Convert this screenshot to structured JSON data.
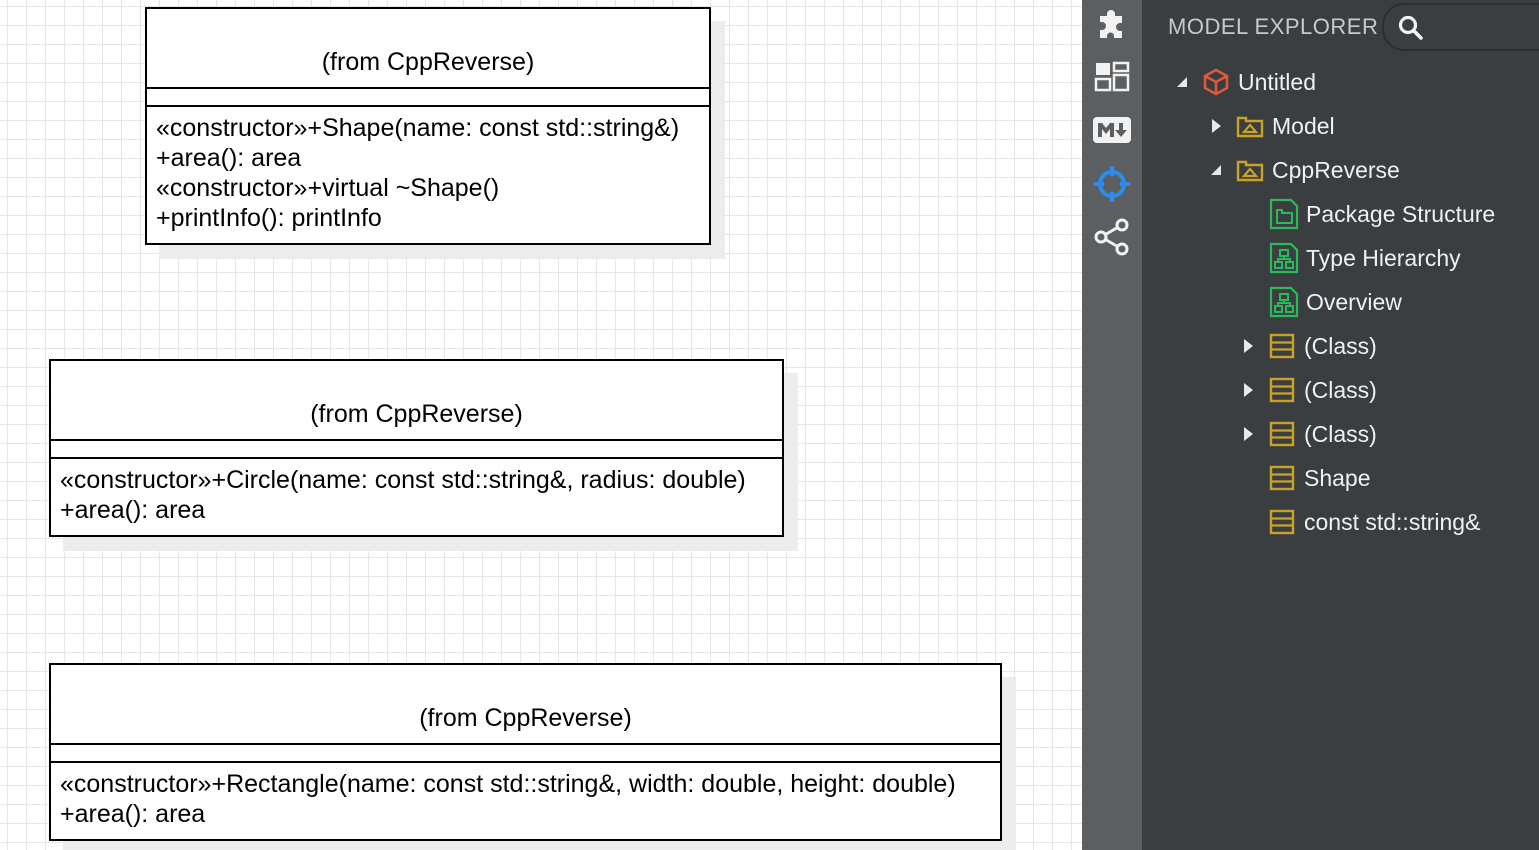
{
  "diagram": {
    "classes": [
      {
        "from": "(from CppReverse)",
        "operations": [
          "«constructor»+Shape(name: const std::string&)",
          "+area(): area",
          "«constructor»+virtual ~Shape()",
          "+printInfo(): printInfo"
        ]
      },
      {
        "from": "(from CppReverse)",
        "operations": [
          "«constructor»+Circle(name: const std::string&, radius: double)",
          "+area(): area"
        ]
      },
      {
        "from": "(from CppReverse)",
        "operations": [
          "«constructor»+Rectangle(name: const std::string&, width: double, height: double)",
          "+area(): area"
        ]
      }
    ]
  },
  "activity_bar": {
    "items": [
      "puzzle-icon",
      "dashboard-icon",
      "markdown-icon",
      "crosshair-icon",
      "share-icon"
    ],
    "active": "crosshair-icon",
    "active_color": "#2d8cf0"
  },
  "explorer": {
    "title": "MODEL EXPLORER",
    "search_icon": "search-icon",
    "tree": [
      {
        "label": "Untitled",
        "icon": "project-cube-icon",
        "state": "expanded"
      },
      {
        "label": "Model",
        "icon": "package-icon",
        "state": "collapsed"
      },
      {
        "label": "CppReverse",
        "icon": "package-icon",
        "state": "expanded"
      },
      {
        "label": "Package Structure",
        "icon": "package-diagram-icon",
        "state": "leaf"
      },
      {
        "label": "Type Hierarchy",
        "icon": "class-diagram-icon",
        "state": "leaf"
      },
      {
        "label": "Overview",
        "icon": "class-diagram-icon",
        "state": "leaf"
      },
      {
        "label": "(Class)",
        "icon": "class-icon",
        "state": "collapsed"
      },
      {
        "label": "(Class)",
        "icon": "class-icon",
        "state": "collapsed"
      },
      {
        "label": "(Class)",
        "icon": "class-icon",
        "state": "collapsed"
      },
      {
        "label": "Shape",
        "icon": "class-icon",
        "state": "leaf"
      },
      {
        "label": "const std::string&",
        "icon": "class-icon",
        "state": "leaf"
      }
    ],
    "colors": {
      "package": "#c9a227",
      "diagram": "#2eb85c",
      "project": "#e05a3a"
    }
  }
}
